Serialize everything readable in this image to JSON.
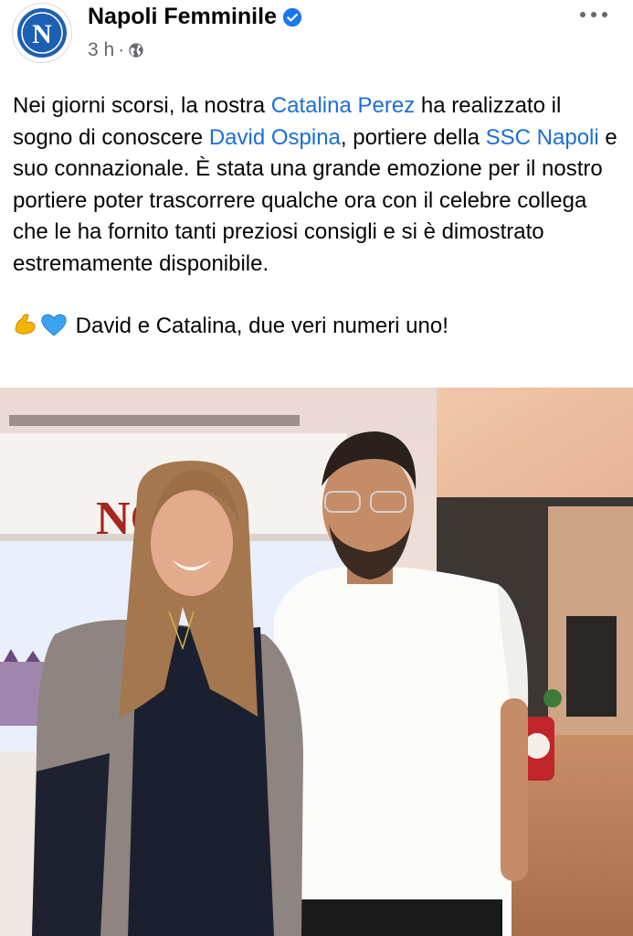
{
  "post": {
    "author": "Napoli Femminile",
    "time": "3 h",
    "separator": "·",
    "logo_letter": "N",
    "paragraph1": {
      "t1": "Nei giorni scorsi, la nostra ",
      "link1": "Catalina Perez",
      "t2": " ha realizzato il sogno di conoscere ",
      "link2": "David Ospina",
      "t3": ", portiere della ",
      "link3": "SSC Napoli",
      "t4": " e suo connazionale. È stata una grande emozione per il nostro portiere poter trascorrere qualche ora con il celebre collega che le ha fornito tanti preziosi consigli e si è dimostrato estremamente disponibile."
    },
    "paragraph2": "David e Catalina, due veri numeri uno!",
    "photo_sign_text": "NO"
  },
  "icons": {
    "verified": "verified-badge-icon",
    "audience": "globe-icon",
    "more": "more-options-icon",
    "emoji1": "flexed-biceps-emoji",
    "emoji2": "blue-heart-emoji"
  },
  "colors": {
    "link": "#1a6ed8",
    "verified": "#1877f2",
    "napoli_blue": "#1d5fb4",
    "meta_gray": "#65676b"
  }
}
